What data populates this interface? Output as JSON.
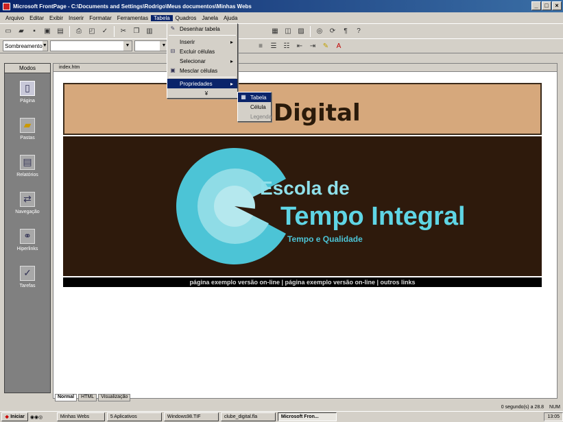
{
  "window": {
    "title": "Microsoft FrontPage - C:\\Documents and Settings\\Rodrigo\\Meus documentos\\Minhas Webs"
  },
  "menubar": [
    "Arquivo",
    "Editar",
    "Exibir",
    "Inserir",
    "Formatar",
    "Ferramentas",
    "Tabela",
    "Quadros",
    "Janela",
    "Ajuda"
  ],
  "toolbar2": {
    "style_combo": "Sombreamento"
  },
  "views_bar": {
    "title": "Modos",
    "items": [
      "Página",
      "Pastas",
      "Relatórios",
      "Navegação",
      "Hiperlinks",
      "Tarefas"
    ]
  },
  "editor": {
    "tab": "index.htm",
    "banner_title": "e Digital",
    "hero_line1": "Escola de",
    "hero_line2": "Tempo Integral",
    "hero_line3": "Tempo e Qualidade",
    "links_bar": "página exemplo versão on-line | página exemplo versão on-line | outros links",
    "view_tabs": [
      "Normal",
      "HTML",
      "Visualização"
    ]
  },
  "table_menu": {
    "items": [
      {
        "label": "Desenhar tabela",
        "icon": "pencil-icon"
      },
      {
        "label": "Inserir",
        "submenu": true
      },
      {
        "label": "Excluir células",
        "icon": "delete-cells-icon"
      },
      {
        "label": "Selecionar",
        "submenu": true
      },
      {
        "label": "Mesclar células",
        "icon": "merge-icon"
      },
      {
        "label": "Propriedades",
        "submenu": true,
        "highlighted": true
      }
    ]
  },
  "properties_submenu": {
    "items": [
      {
        "label": "Tabela",
        "highlighted": true
      },
      {
        "label": "Célula"
      },
      {
        "label": "Legenda",
        "disabled": true
      }
    ]
  },
  "statusbar": {
    "time": "0 segundo(s) a 28.8",
    "mode": "NUM"
  },
  "taskbar": {
    "start": "Iniciar",
    "buttons": [
      "Minhas Webs",
      "5 Aplicativos",
      "Windows98.TIF",
      "clube_digital.fla",
      "Microsoft Fron..."
    ],
    "active_index": 4,
    "clock": "13:05"
  },
  "colors": {
    "banner": "#d6a87c",
    "hero_bg": "#2e1a0c",
    "cyan": "#5fd5e5",
    "selection": "#0a246a"
  }
}
